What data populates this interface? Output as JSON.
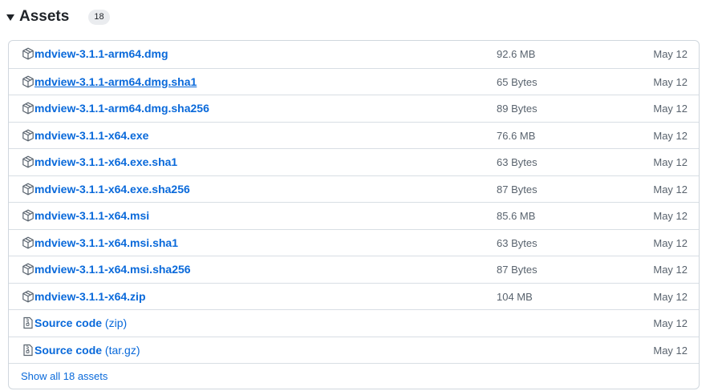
{
  "header": {
    "title": "Assets",
    "count": "18",
    "caret_icon": "triangle-down-icon"
  },
  "assets": [
    {
      "name": "mdview-3.1.1-arm64.dmg",
      "suffix": "",
      "size": "92.6 MB",
      "date": "May 12",
      "icon": "package-icon",
      "underlined": false
    },
    {
      "name": "mdview-3.1.1-arm64.dmg.sha1",
      "suffix": "",
      "size": "65 Bytes",
      "date": "May 12",
      "icon": "package-icon",
      "underlined": true
    },
    {
      "name": "mdview-3.1.1-arm64.dmg.sha256",
      "suffix": "",
      "size": "89 Bytes",
      "date": "May 12",
      "icon": "package-icon",
      "underlined": false
    },
    {
      "name": "mdview-3.1.1-x64.exe",
      "suffix": "",
      "size": "76.6 MB",
      "date": "May 12",
      "icon": "package-icon",
      "underlined": false
    },
    {
      "name": "mdview-3.1.1-x64.exe.sha1",
      "suffix": "",
      "size": "63 Bytes",
      "date": "May 12",
      "icon": "package-icon",
      "underlined": false
    },
    {
      "name": "mdview-3.1.1-x64.exe.sha256",
      "suffix": "",
      "size": "87 Bytes",
      "date": "May 12",
      "icon": "package-icon",
      "underlined": false
    },
    {
      "name": "mdview-3.1.1-x64.msi",
      "suffix": "",
      "size": "85.6 MB",
      "date": "May 12",
      "icon": "package-icon",
      "underlined": false
    },
    {
      "name": "mdview-3.1.1-x64.msi.sha1",
      "suffix": "",
      "size": "63 Bytes",
      "date": "May 12",
      "icon": "package-icon",
      "underlined": false
    },
    {
      "name": "mdview-3.1.1-x64.msi.sha256",
      "suffix": "",
      "size": "87 Bytes",
      "date": "May 12",
      "icon": "package-icon",
      "underlined": false
    },
    {
      "name": "mdview-3.1.1-x64.zip",
      "suffix": "",
      "size": "104 MB",
      "date": "May 12",
      "icon": "package-icon",
      "underlined": false
    },
    {
      "name": "Source code",
      "suffix": "(zip)",
      "size": "",
      "date": "May 12",
      "icon": "file-zip-icon",
      "underlined": false
    },
    {
      "name": "Source code",
      "suffix": "(tar.gz)",
      "size": "",
      "date": "May 12",
      "icon": "file-zip-icon",
      "underlined": false
    }
  ],
  "footer": {
    "show_all_label": "Show all 18 assets"
  },
  "colors": {
    "link": "#0969da",
    "muted": "#59636e",
    "border": "#d0d7de",
    "badge_bg": "#eaecef"
  }
}
